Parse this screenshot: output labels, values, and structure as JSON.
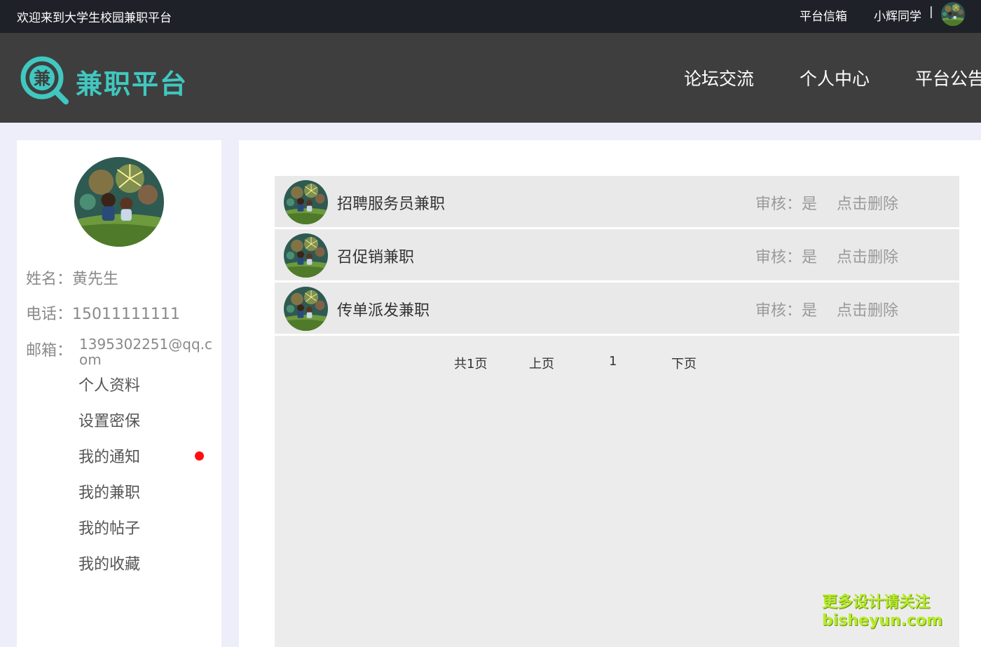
{
  "topbar": {
    "welcome": "欢迎来到大学生校园兼职平台",
    "mailbox": "平台信箱",
    "username": "小辉同学",
    "separator": "|"
  },
  "header": {
    "logo_char": "兼",
    "brand": "兼职平台",
    "nav": [
      "论坛交流",
      "个人中心",
      "平台公告"
    ]
  },
  "profile": {
    "name_label": "姓名：",
    "name": "黄先生",
    "phone_label": "电话：",
    "phone": "15011111111",
    "email_label": "邮箱：",
    "email": "1395302251@qq.com"
  },
  "menu": [
    "个人资料",
    "设置密保",
    "我的通知",
    "我的兼职",
    "我的帖子",
    "我的收藏"
  ],
  "jobs": [
    {
      "title": "招聘服务员兼职",
      "audit": "审核：是",
      "action": "点击删除"
    },
    {
      "title": "召促销兼职",
      "audit": "审核：是",
      "action": "点击删除"
    },
    {
      "title": "传单派发兼职",
      "audit": "审核：是",
      "action": "点击删除"
    }
  ],
  "pager": {
    "total": "共1页",
    "prev": "上页",
    "current": "1",
    "next": "下页"
  },
  "watermark": {
    "line1": "更多设计请关注",
    "line2": "bisheyun.com"
  },
  "colors": {
    "brand": "#40c8c0",
    "topbar": "#1f2129",
    "header": "#3e3e3e",
    "notice_dot": "#ff1010"
  }
}
